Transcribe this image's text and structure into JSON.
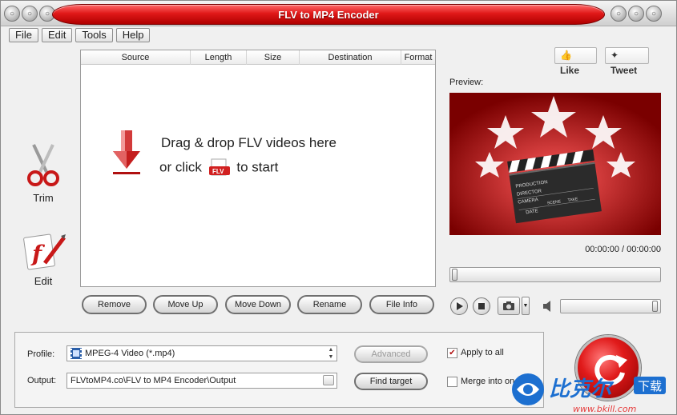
{
  "window": {
    "title": "FLV to MP4 Encoder"
  },
  "menu": [
    "File",
    "Edit",
    "Tools",
    "Help"
  ],
  "tools": {
    "trim": "Trim",
    "edit": "Edit"
  },
  "filelist": {
    "columns": [
      "Source",
      "Length",
      "Size",
      "Destination",
      "Format"
    ],
    "drop_line1": "Drag & drop FLV videos here",
    "drop_line2_pre": "or click",
    "drop_line2_post": "to start",
    "flv_badge": "FLV"
  },
  "list_buttons": [
    "Remove",
    "Move Up",
    "Move Down",
    "Rename",
    "File Info"
  ],
  "social": {
    "like": "Like",
    "tweet": "Tweet"
  },
  "preview": {
    "label": "Preview:",
    "time": "00:00:00 / 00:00:00",
    "clapper_lines": [
      "PRODUCTION",
      "DIRECTOR",
      "CAMERA",
      "DATE",
      "SCENE",
      "TAKE"
    ]
  },
  "output": {
    "profile_label": "Profile:",
    "profile_value": "MPEG-4 Video (*.mp4)",
    "output_label": "Output:",
    "output_value": "FLVtoMP4.co\\FLV to MP4 Encoder\\Output",
    "advanced_label": "Advanced",
    "find_target_label": "Find target",
    "apply_all_label": "Apply to all",
    "apply_all_checked": true,
    "merge_label": "Merge into one",
    "merge_checked": false
  },
  "watermark": {
    "brand": "比克尔",
    "download": "下载",
    "url": "www.bkill.com"
  },
  "colors": {
    "title_red": "#e01818",
    "accent_red": "#b00000"
  }
}
